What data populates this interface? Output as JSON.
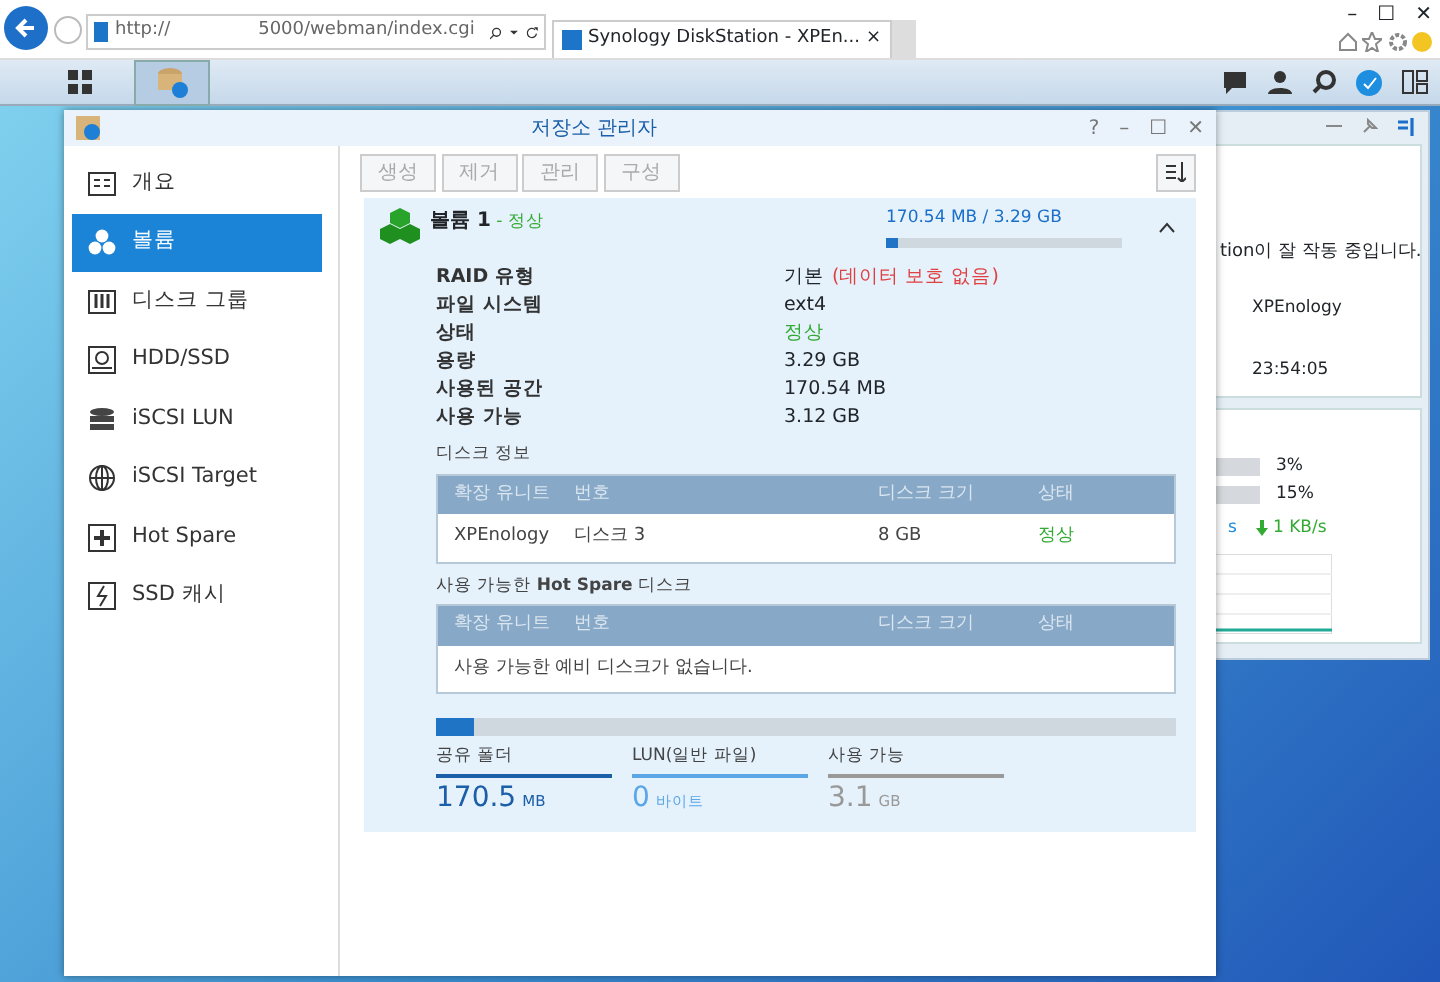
{
  "browser": {
    "address_scheme": "http://",
    "address_path": "5000/webman/index.cgi",
    "tab": {
      "title": "Synology DiskStation - XPEn...",
      "close": "×"
    },
    "controls": [
      "–",
      "☐",
      "✕"
    ]
  },
  "taskbar": {
    "apps": [
      {
        "kind": "menu",
        "selected": false
      },
      {
        "kind": "storage",
        "selected": true
      }
    ]
  },
  "window": {
    "title": "저장소 관리자",
    "buttons": [
      "?",
      "–",
      "☐",
      "✕"
    ],
    "sidebar": [
      {
        "label": "개요",
        "selected": false
      },
      {
        "label": "볼륨",
        "selected": true
      },
      {
        "label": "디스크 그룹",
        "selected": false
      },
      {
        "label": "HDD/SSD",
        "selected": false
      },
      {
        "label": "iSCSI LUN",
        "selected": false
      },
      {
        "label": "iSCSI Target",
        "selected": false
      },
      {
        "label": "Hot Spare",
        "selected": false
      },
      {
        "label": "SSD 캐시",
        "selected": false
      }
    ],
    "toolbar": [
      {
        "label": "생성",
        "disabled": true
      },
      {
        "label": "제거",
        "disabled": true
      },
      {
        "label": "관리",
        "disabled": true
      },
      {
        "label": "구성",
        "disabled": true
      }
    ],
    "volume": {
      "name": "볼륨 1",
      "status": " - 정상",
      "usage": "170.54 MB / 3.29 GB",
      "level": 0.05,
      "expanded": true,
      "properties": [
        {
          "label": "RAID 유형",
          "value": "기본",
          "note": "(데이터 보호 없음)",
          "kind": "text"
        },
        {
          "label": "파일 시스템",
          "value": "ext4",
          "kind": "text"
        },
        {
          "label": "상태",
          "value": "정상",
          "kind": "status"
        },
        {
          "label": "용량",
          "value": "3.29 GB",
          "kind": "text"
        },
        {
          "label": "사용된 공간",
          "value": "170.54 MB",
          "kind": "text"
        },
        {
          "label": "사용 가능",
          "value": "3.12 GB",
          "kind": "text"
        }
      ],
      "disk_info": {
        "title": "디스크 정보",
        "columns": [
          "확장 유니트",
          "번호",
          "디스크 크기",
          "상태"
        ],
        "rows": [
          [
            "XPEnology",
            "디스크 3",
            "8 GB",
            "정상"
          ]
        ]
      },
      "hot_spare": {
        "title": "사용 가능한 **Hot Spare** 디스크",
        "columns": [
          "확장 유니트",
          "번호",
          "디스크 크기",
          "상태"
        ],
        "empty": "사용 가능한 예비 디스크가 없습니다."
      },
      "breakdown": {
        "level": 0.05
      },
      "stats": [
        {
          "label": "공유 폴더",
          "value": "170.5",
          "unit": "MB",
          "color": "#1b5fa8"
        },
        {
          "label": "LUN(일반 파일)",
          "value": "0",
          "unit": "바이트",
          "color": "#5aa6e6"
        },
        {
          "label": "사용 가능",
          "value": "3.1",
          "unit": "GB",
          "color": "#999999"
        }
      ]
    }
  },
  "widgets": {
    "status": {
      "message": "tion이 잘 작동 중입니다.",
      "server": "XPEnology",
      "time": "23:54:05"
    },
    "resources": [
      {
        "reading": "3%"
      },
      {
        "reading": "15%"
      }
    ],
    "upload_tail": "s",
    "download": "1 KB/s"
  }
}
